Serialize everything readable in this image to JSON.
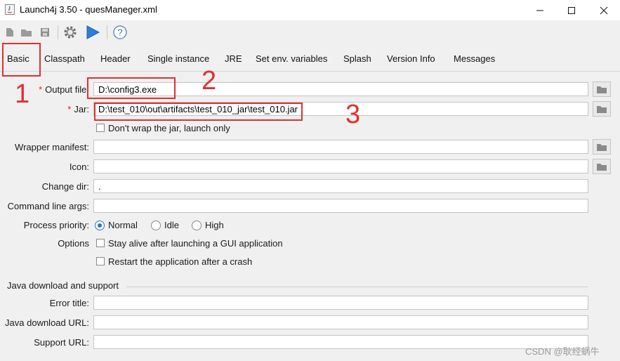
{
  "window": {
    "title": "Launch4j 3.50 - quesManeger.xml",
    "controls": [
      "minimize",
      "maximize",
      "close"
    ]
  },
  "toolbar": {
    "icons": [
      "new-file-icon",
      "open-folder-icon",
      "save-icon",
      "build-gear-icon",
      "run-play-icon",
      "help-icon"
    ]
  },
  "tabs": [
    {
      "label": "Basic",
      "selected": true
    },
    {
      "label": "Classpath"
    },
    {
      "label": "Header"
    },
    {
      "label": "Single instance"
    },
    {
      "label": "JRE"
    },
    {
      "label": "Set env. variables"
    },
    {
      "label": "Splash"
    },
    {
      "label": "Version Info"
    },
    {
      "label": "Messages"
    }
  ],
  "form": {
    "output_file": {
      "label": "Output file:",
      "value": "D:\\config3.exe",
      "required_mark": "*"
    },
    "jar": {
      "label": "Jar:",
      "value": "D:\\test_010\\out\\artifacts\\test_010_jar\\test_010.jar",
      "required_mark": "*"
    },
    "dont_wrap": {
      "label": "Don't wrap the jar, launch only",
      "checked": false
    },
    "wrapper_manifest": {
      "label": "Wrapper manifest:",
      "value": ""
    },
    "icon": {
      "label": "Icon:",
      "value": ""
    },
    "change_dir": {
      "label": "Change dir:",
      "value": "."
    },
    "cmd_args": {
      "label": "Command line args:",
      "value": ""
    },
    "priority": {
      "label": "Process priority:",
      "options": [
        "Normal",
        "Idle",
        "High"
      ],
      "selected": "Normal"
    },
    "options": {
      "label": "Options",
      "stay_alive": {
        "label": "Stay alive after launching a GUI application",
        "checked": false
      },
      "restart": {
        "label": "Restart the application after a crash",
        "checked": false
      }
    }
  },
  "java_download": {
    "section_title": "Java download and support",
    "error_title": {
      "label": "Error title:",
      "value": ""
    },
    "download_url": {
      "label": "Java download URL:",
      "value": ""
    },
    "support_url": {
      "label": "Support URL:",
      "value": ""
    }
  },
  "annotations": {
    "n1": "1",
    "n2": "2",
    "n3": "3",
    "color": "#e03030"
  },
  "watermark": "CSDN @耿经蜗牛"
}
